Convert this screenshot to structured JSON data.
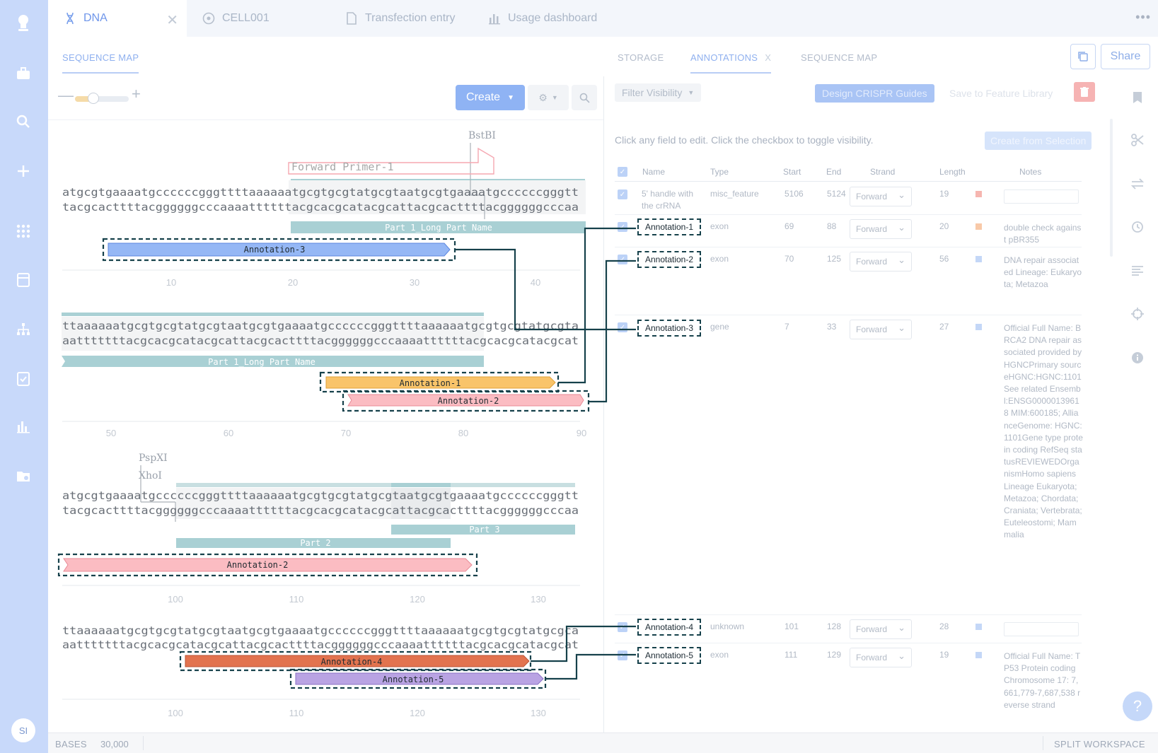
{
  "file_tabs": [
    {
      "label": "DNA",
      "icon": "dna-icon",
      "active": true
    },
    {
      "label": "CELL001",
      "icon": "cell-icon"
    },
    {
      "label": "Transfection entry",
      "icon": "document-icon"
    },
    {
      "label": "Usage dashboard",
      "icon": "bar-chart-icon"
    }
  ],
  "left_tab": "SEQUENCE MAP",
  "right_tabs": [
    "STORAGE",
    "ANNOTATIONS",
    "SEQUENCE MAP"
  ],
  "right_tab_close": "X",
  "share_label": "Share",
  "toolbar": {
    "create_label": "Create"
  },
  "actions": {
    "filter_label": "Filter Visibility",
    "crispr_label": "Design CRISPR Guides",
    "feature_library_label": "Save to Feature Library"
  },
  "hint": "Click any field to edit. Click the checkbox to toggle visibility.",
  "create_from_selection": "Create from Selection",
  "table": {
    "headers": [
      "Name",
      "Type",
      "Start",
      "End",
      "Strand",
      "Length",
      "Notes"
    ],
    "rows": [
      {
        "name": "5' handle with the crRNA",
        "type": "misc_feature",
        "start": "5106",
        "end": "5124",
        "strand": "Forward",
        "length": "19",
        "color": "#f6b6b0",
        "notes": ""
      },
      {
        "name": "Annotation-1",
        "type": "exon",
        "start": "69",
        "end": "88",
        "strand": "Forward",
        "length": "20",
        "color": "#f8c9a8",
        "notes": "double check against pBR355"
      },
      {
        "name": "Annotation-2",
        "type": "exon",
        "start": "70",
        "end": "125",
        "strand": "Forward",
        "length": "56",
        "color": "#c4d7f7",
        "notes": "DNA repair associated Lineage: Eukaryota; Metazoa"
      },
      {
        "name": "Annotation-3",
        "type": "gene",
        "start": "7",
        "end": "33",
        "strand": "Forward",
        "length": "27",
        "color": "#c4d7f7",
        "notes": "Official Full Name: BRCA2 DNA repair associated provided by HGNCPrimary sourceHGNC:HGNC:1101See related Ensembl:ENSG00000139618 MIM:600185; AllianceGenome: HGNC:1101Gene type protein coding RefSeq statusREVIEWEDOrganismHomo sapiens Lineage Eukaryota; Metazoa; Chordata; Craniata; Vertebrata; Euteleostomi; Mammalia"
      },
      {
        "name": "Annotation-4",
        "type": "unknown",
        "start": "101",
        "end": "128",
        "strand": "Forward",
        "length": "28",
        "color": "#c4d7f7",
        "notes": ""
      },
      {
        "name": "Annotation-5",
        "type": "exon",
        "start": "111",
        "end": "129",
        "strand": "Forward",
        "length": "19",
        "color": "#c4d7f7",
        "notes": "Official Full Name: TP53 Protein coding Chromosome 17: 7,661,779-7,687,538 reverse strand"
      }
    ]
  },
  "sequence": {
    "rows": [
      {
        "top": "atgcgtgaaaatgccccccgggttttaaaaaatgcgtgcgtatgcgtaatgcgtgaaaatgccccccgggtt",
        "bottom": "tacgcacttttacggggggcccaaaattttttacgcacgcatacgcattacgcacttttacggggggcccaa",
        "ticks": [
          "10",
          "20",
          "30",
          "40"
        ]
      },
      {
        "top": "ttaaaaaatgcgtgcgtatgcgtaatgcgtgaaaatgccccccgggttttaaaaaatgcgtgcgtatgcgta",
        "bottom": "aatttttttacgcacgcatacgcattacgcacttttacggggggcccaaaattttttacgcacgcatacgcat",
        "ticks": [
          "50",
          "60",
          "70",
          "80",
          "90"
        ]
      },
      {
        "top": "atgcgtgaaaatgccccccgggttttaaaaaatgcgtgcgtatgcgtaatgcgtgaaaatgccccccgggtt",
        "bottom": "tacgcacttttacggggggcccaaaattttttacgcacgcatacgcattacgcacttttacggggggcccaa",
        "ticks": [
          "100",
          "110",
          "120",
          "130"
        ]
      },
      {
        "top": "ttaaaaaatgcgtgcgtatgcgtaatgcgtgaaaatgccccccgggttttaaaaaatgcgtgcgtatgcgca",
        "bottom": "aatttttttacgcacgcatacgcattacgcacttttacggggggcccaaaattttttacgcacgcatacgcat",
        "ticks": [
          "100",
          "110",
          "120",
          "130"
        ]
      }
    ],
    "enzymes": [
      "BstBI",
      "PspXI",
      "XhoI"
    ],
    "primer": "Forward Primer-1",
    "parts": [
      "Part 1_Long Part Name",
      "Part 1_Long Part Name",
      "Part 3",
      "Part 2"
    ],
    "annotations": [
      "Annotation-3",
      "Annotation-1",
      "Annotation-2",
      "Annotation-2",
      "Annotation-4",
      "Annotation-5"
    ]
  },
  "colors": {
    "annotation_blue": "#95b7f5",
    "annotation_orange": "#f9c46a",
    "annotation_pink": "#fbbcc2",
    "annotation_red": "#e2734f",
    "annotation_purple": "#b9a3e3",
    "part_teal": "#a9d0d4",
    "connector": "#16414b",
    "rail": "#c8d9fa"
  },
  "footer": {
    "bases_label": "BASES",
    "bases_value": "30,000",
    "split_label": "SPLIT WORKSPACE"
  },
  "user_initials": "SI"
}
